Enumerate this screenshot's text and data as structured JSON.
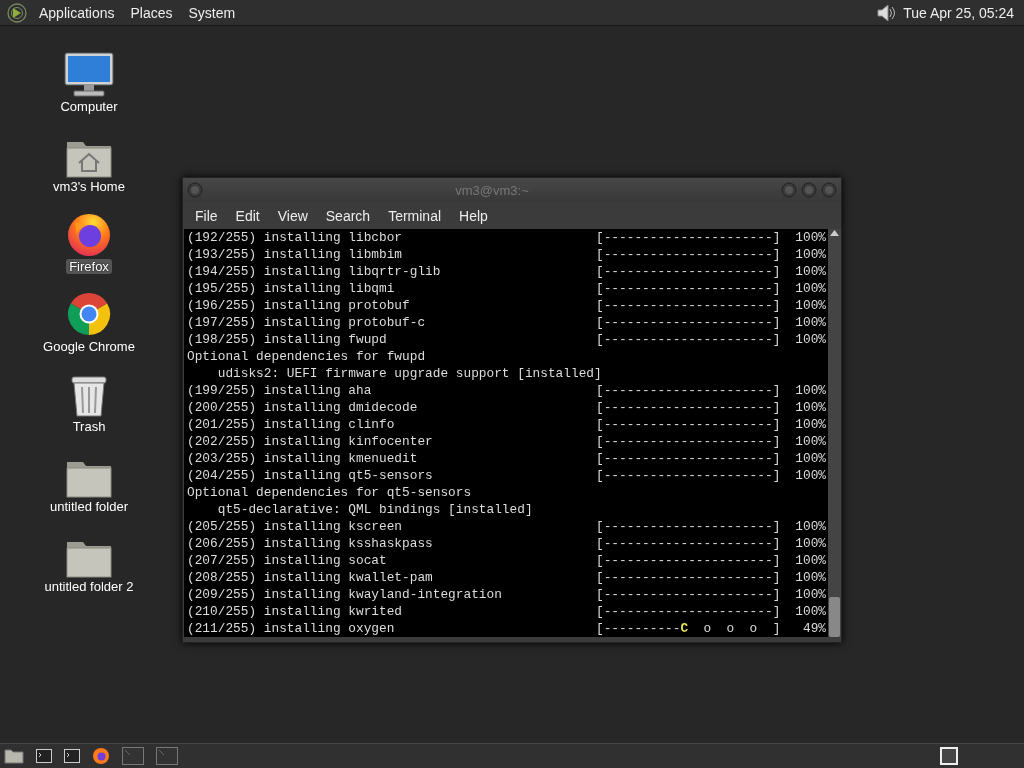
{
  "top_panel": {
    "menus": [
      "Applications",
      "Places",
      "System"
    ],
    "clock": "Tue Apr 25, 05:24"
  },
  "desktop_icons": [
    {
      "label": "Computer",
      "kind": "computer",
      "selected": false
    },
    {
      "label": "vm3's Home",
      "kind": "home",
      "selected": false
    },
    {
      "label": "Firefox",
      "kind": "firefox",
      "selected": true
    },
    {
      "label": "Google Chrome",
      "kind": "chrome",
      "selected": false
    },
    {
      "label": "Trash",
      "kind": "trash",
      "selected": false
    },
    {
      "label": "untitled folder",
      "kind": "folder",
      "selected": false
    },
    {
      "label": "untitled folder 2",
      "kind": "folder",
      "selected": false
    }
  ],
  "terminal": {
    "title": "vm3@vm3:~",
    "menu": [
      "File",
      "Edit",
      "View",
      "Search",
      "Terminal",
      "Help"
    ],
    "lines": [
      {
        "kind": "progress",
        "text": "(192/255) installing libcbor",
        "bar": "[----------------------]",
        "percent": "100%"
      },
      {
        "kind": "progress",
        "text": "(193/255) installing libmbim",
        "bar": "[----------------------]",
        "percent": "100%"
      },
      {
        "kind": "progress",
        "text": "(194/255) installing libqrtr-glib",
        "bar": "[----------------------]",
        "percent": "100%"
      },
      {
        "kind": "progress",
        "text": "(195/255) installing libqmi",
        "bar": "[----------------------]",
        "percent": "100%"
      },
      {
        "kind": "progress",
        "text": "(196/255) installing protobuf",
        "bar": "[----------------------]",
        "percent": "100%"
      },
      {
        "kind": "progress",
        "text": "(197/255) installing protobuf-c",
        "bar": "[----------------------]",
        "percent": "100%"
      },
      {
        "kind": "progress",
        "text": "(198/255) installing fwupd",
        "bar": "[----------------------]",
        "percent": "100%"
      },
      {
        "kind": "text",
        "text": "Optional dependencies for fwupd"
      },
      {
        "kind": "text",
        "text": "    udisks2: UEFI firmware upgrade support [installed]"
      },
      {
        "kind": "progress",
        "text": "(199/255) installing aha",
        "bar": "[----------------------]",
        "percent": "100%"
      },
      {
        "kind": "progress",
        "text": "(200/255) installing dmidecode",
        "bar": "[----------------------]",
        "percent": "100%"
      },
      {
        "kind": "progress",
        "text": "(201/255) installing clinfo",
        "bar": "[----------------------]",
        "percent": "100%"
      },
      {
        "kind": "progress",
        "text": "(202/255) installing kinfocenter",
        "bar": "[----------------------]",
        "percent": "100%"
      },
      {
        "kind": "progress",
        "text": "(203/255) installing kmenuedit",
        "bar": "[----------------------]",
        "percent": "100%"
      },
      {
        "kind": "progress",
        "text": "(204/255) installing qt5-sensors",
        "bar": "[----------------------]",
        "percent": "100%"
      },
      {
        "kind": "text",
        "text": "Optional dependencies for qt5-sensors"
      },
      {
        "kind": "text",
        "text": "    qt5-declarative: QML bindings [installed]"
      },
      {
        "kind": "progress",
        "text": "(205/255) installing kscreen",
        "bar": "[----------------------]",
        "percent": "100%"
      },
      {
        "kind": "progress",
        "text": "(206/255) installing ksshaskpass",
        "bar": "[----------------------]",
        "percent": "100%"
      },
      {
        "kind": "progress",
        "text": "(207/255) installing socat",
        "bar": "[----------------------]",
        "percent": "100%"
      },
      {
        "kind": "progress",
        "text": "(208/255) installing kwallet-pam",
        "bar": "[----------------------]",
        "percent": "100%"
      },
      {
        "kind": "progress",
        "text": "(209/255) installing kwayland-integration",
        "bar": "[----------------------]",
        "percent": "100%"
      },
      {
        "kind": "progress",
        "text": "(210/255) installing kwrited",
        "bar": "[----------------------]",
        "percent": "100%"
      },
      {
        "kind": "pacman",
        "text": "(211/255) installing oxygen",
        "bar_done": "[----------",
        "pacman": "C",
        "bar_rest": "  o  o  o  ]",
        "percent": "49%"
      }
    ]
  },
  "taskbar": {
    "items": [
      {
        "kind": "folder"
      },
      {
        "kind": "terminal"
      },
      {
        "kind": "terminal"
      },
      {
        "kind": "firefox"
      },
      {
        "kind": "window"
      },
      {
        "kind": "window"
      }
    ]
  }
}
